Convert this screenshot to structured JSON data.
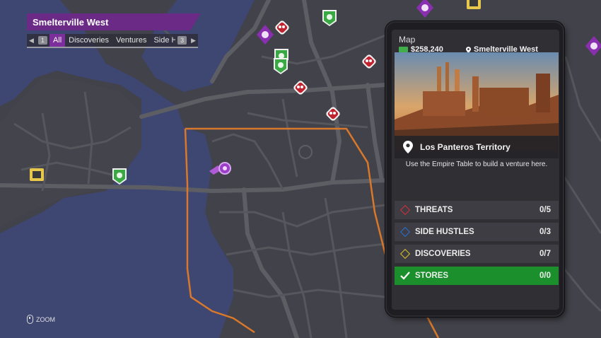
{
  "region": {
    "title": "Smelterville West"
  },
  "filter_bar": {
    "left_key": "1",
    "right_key": "3",
    "tabs": [
      {
        "label": "All",
        "active": true
      },
      {
        "label": "Discoveries",
        "active": false
      },
      {
        "label": "Ventures",
        "active": false
      },
      {
        "label": "Side Hu",
        "active": false
      }
    ]
  },
  "zoom_hint": {
    "icon": "mouse-icon",
    "label": "ZOOM"
  },
  "map_panel": {
    "title": "Map",
    "money": "$258,240",
    "location": "Smelterville West",
    "photo_caption": "Los Panteros Territory",
    "venture_note": "Use the Empire Table to build a venture here.",
    "categories": [
      {
        "label": "THREATS",
        "count": "0/5",
        "color": "#d42f3b",
        "active": false
      },
      {
        "label": "SIDE HUSTLES",
        "count": "0/3",
        "color": "#2a6fd4",
        "active": false
      },
      {
        "label": "DISCOVERIES",
        "count": "0/7",
        "color": "#d8c327",
        "active": false
      },
      {
        "label": "STORES",
        "count": "0/0",
        "color": "#ffffff",
        "active": true
      }
    ]
  },
  "colors": {
    "accent_purple": "#7c2f9c",
    "territory_outline": "#d9782a",
    "stores_green": "#1a8f2b",
    "water": "#3e4672",
    "land": "#42424a",
    "road": "#5d5d64"
  },
  "map_icons": [
    "threat-icon",
    "side-hustle-icon",
    "venture-icon",
    "player-marker-icon",
    "store-icon"
  ]
}
